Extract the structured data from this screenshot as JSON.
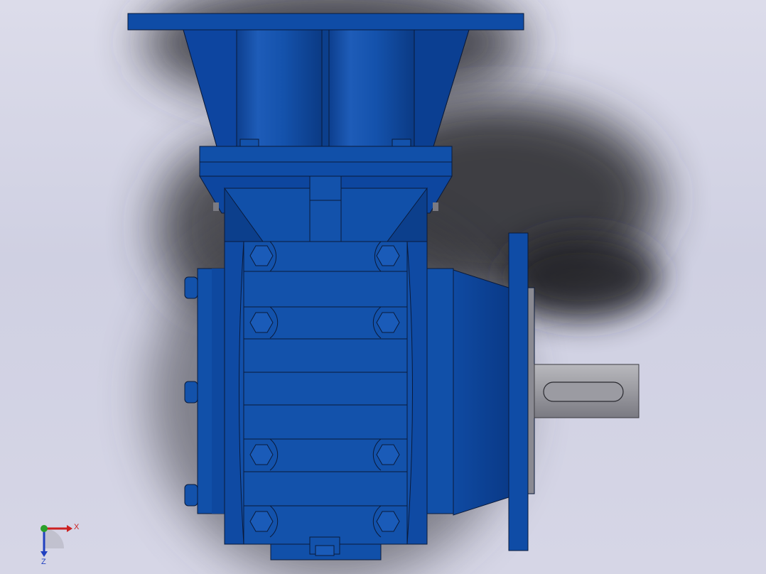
{
  "viewport": {
    "background_top": "#dcdcea",
    "background_bottom": "#d6d6e6"
  },
  "model": {
    "body_color": "#114ea8",
    "body_shade": "#0c3f8c",
    "body_highlight": "#2c6fd0",
    "edge_color": "#0a1a3a",
    "shaft_color": "#a4a4aa",
    "shaft_shade": "#7c7c84",
    "shadow_color": "#2a2a2e"
  },
  "triad": {
    "x_label": "X",
    "z_label": "Z",
    "x_color": "#cc2020",
    "y_color": "#2aa02a",
    "z_color": "#2040c0",
    "icon": "coordinate-triad-icon"
  }
}
